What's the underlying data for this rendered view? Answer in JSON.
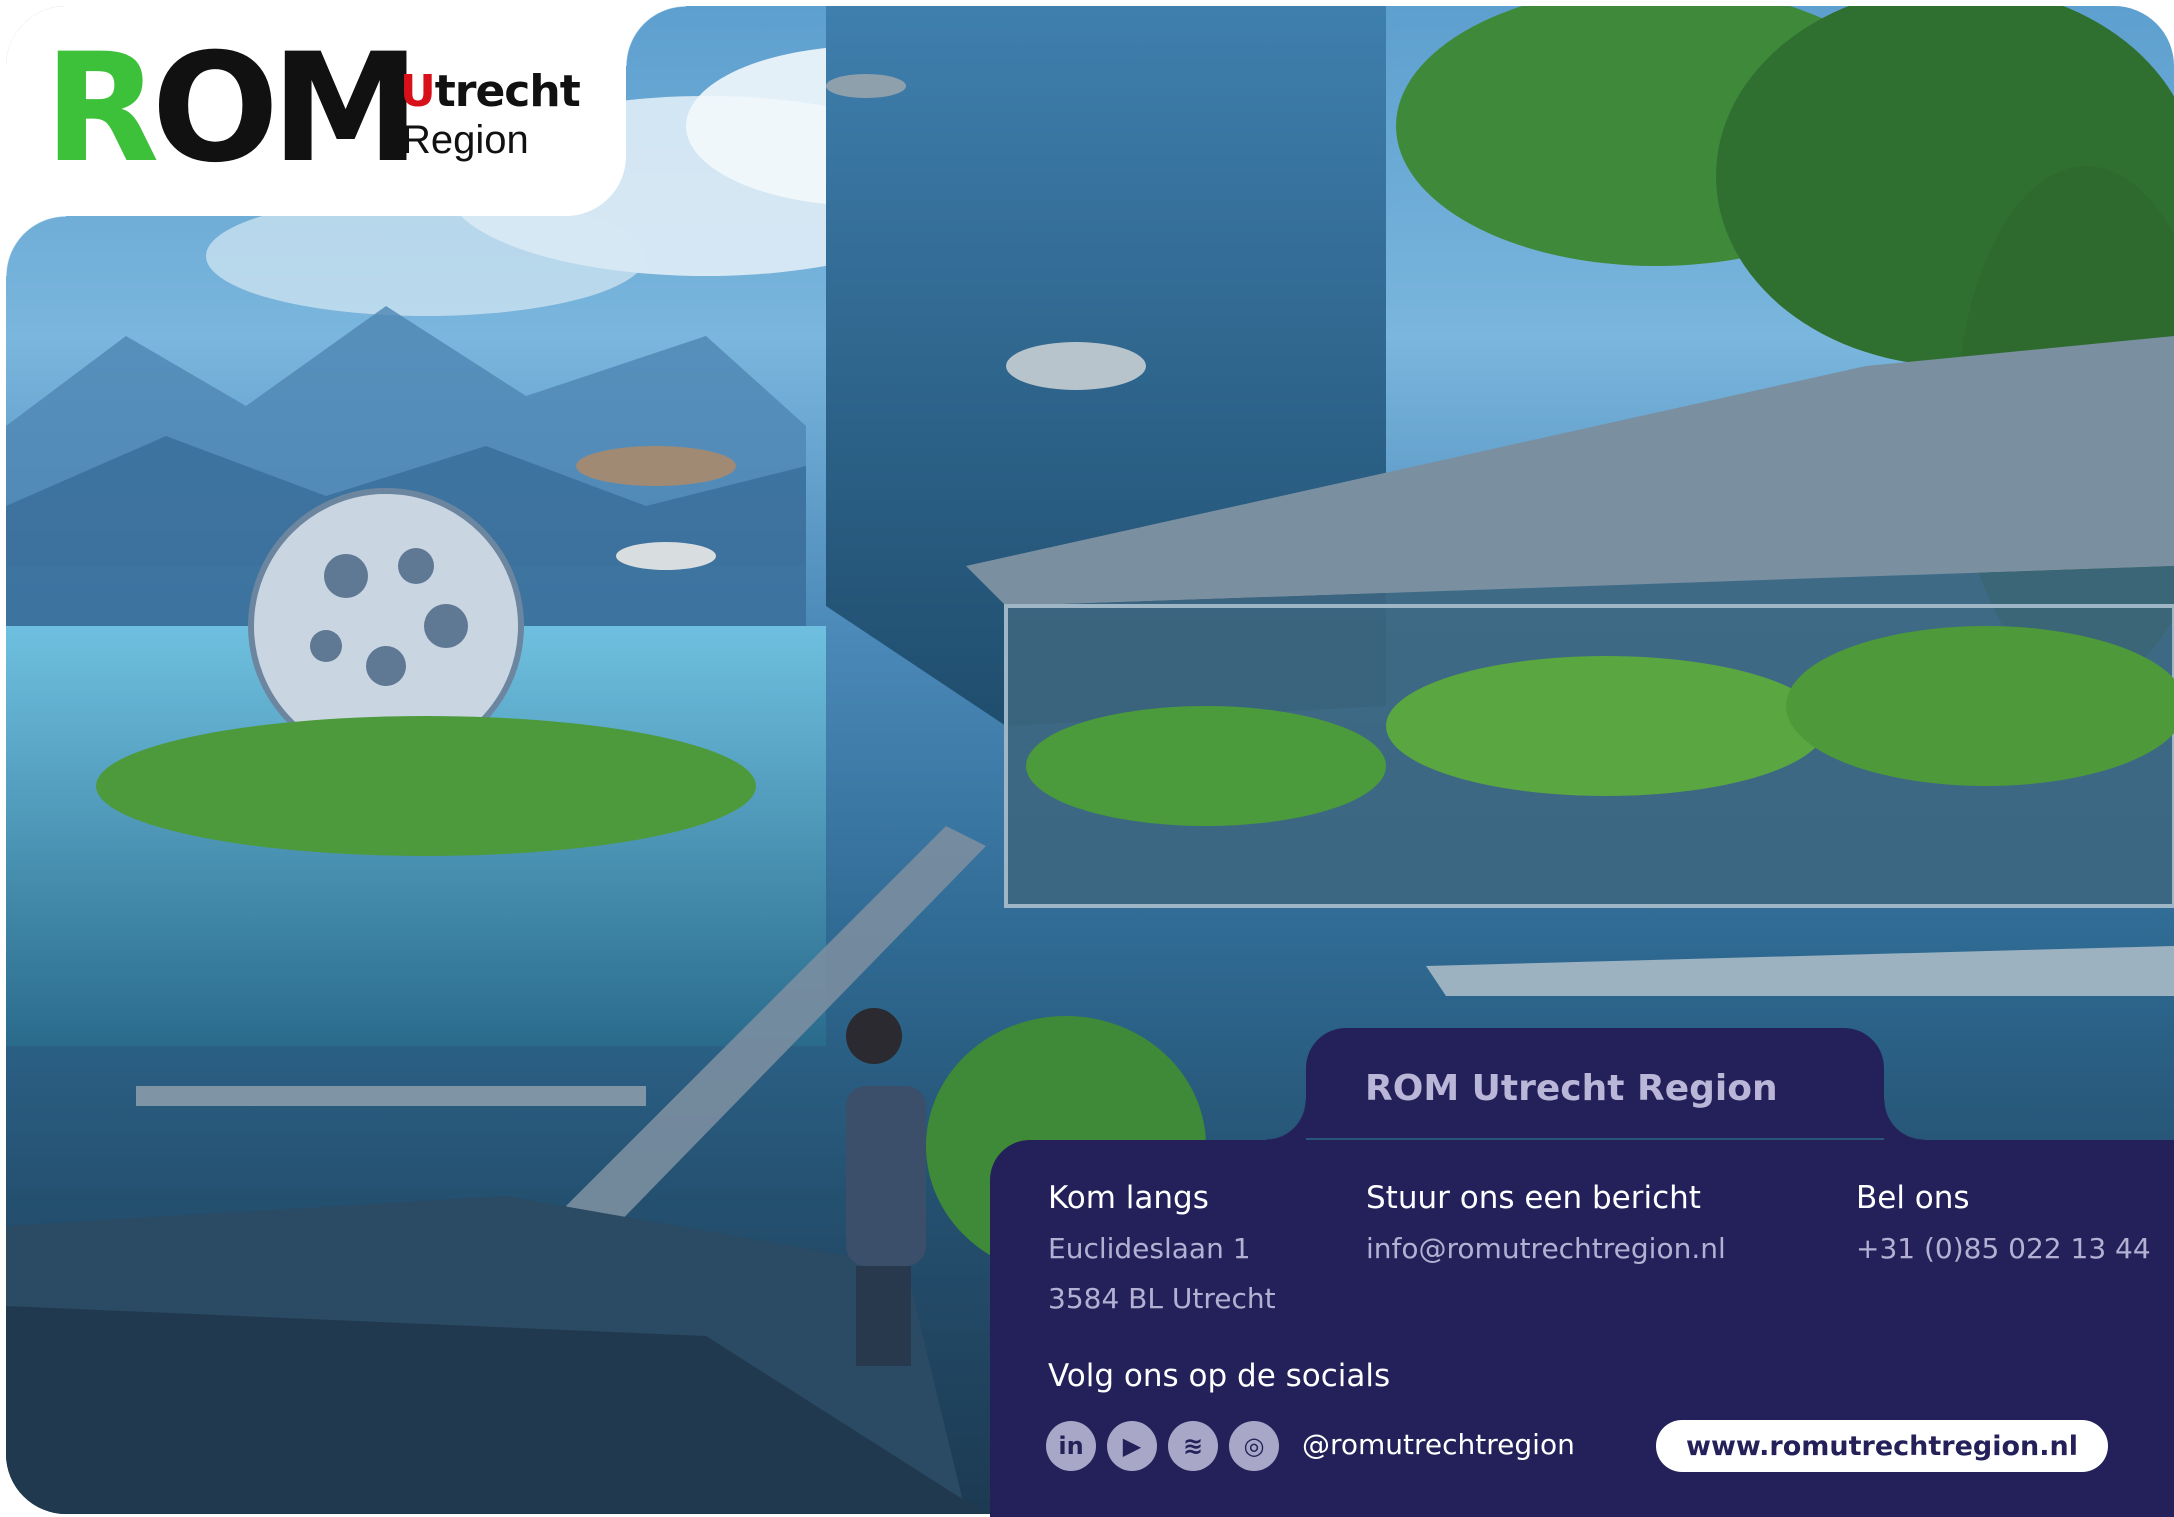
{
  "brand": {
    "logo_text": "ROM",
    "city": "Utrecht",
    "region": "Region"
  },
  "contact_card": {
    "title": "ROM Utrecht Region",
    "visit": {
      "heading": "Kom langs",
      "address_line1": "Euclideslaan 1",
      "address_line2": "3584 BL Utrecht"
    },
    "message": {
      "heading": "Stuur ons een bericht",
      "email": "info@romutrechtregion.nl"
    },
    "call": {
      "heading": "Bel ons",
      "phone": "+31 (0)85 022 13 44"
    },
    "socials": {
      "heading": "Volg ons op de socials",
      "handle": "@romutrechtregion",
      "icons": [
        "linkedin-icon",
        "youtube-icon",
        "spotify-icon",
        "instagram-icon"
      ]
    },
    "website": "www.romutrechtregion.nl"
  },
  "colors": {
    "card_bg": "#24215a",
    "logo_green": "#3ec13a",
    "logo_red": "#d8101a"
  }
}
